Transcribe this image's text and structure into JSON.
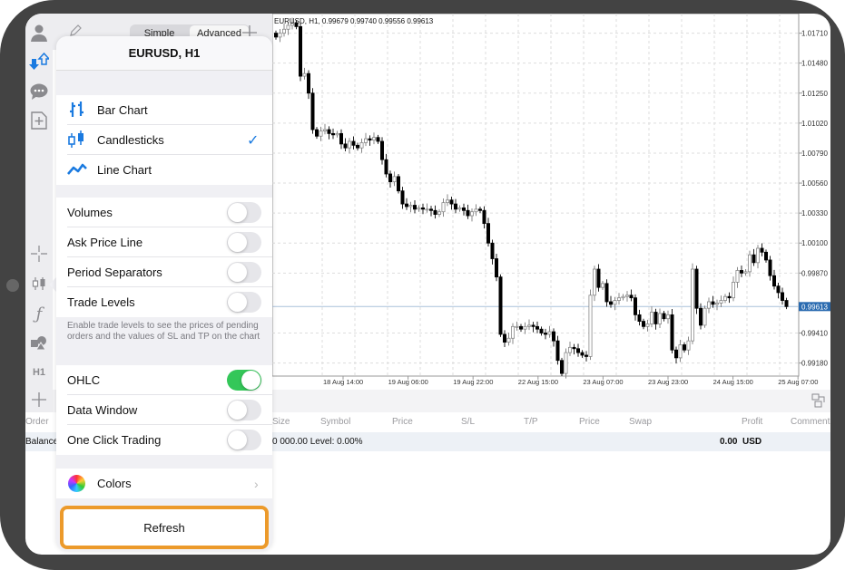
{
  "toolbar": {
    "mode_simple": "Simple",
    "mode_advanced": "Advanced",
    "active_mode": "Advanced"
  },
  "popover": {
    "title": "EURUSD, H1",
    "chart_types": [
      {
        "label": "Bar Chart",
        "icon": "bar-chart-icon",
        "selected": false
      },
      {
        "label": "Candlesticks",
        "icon": "candlestick-icon",
        "selected": true
      },
      {
        "label": "Line Chart",
        "icon": "line-chart-icon",
        "selected": false
      }
    ],
    "check_glyph": "✓",
    "toggles": [
      {
        "label": "Volumes",
        "on": false
      },
      {
        "label": "Ask Price Line",
        "on": false
      },
      {
        "label": "Period Separators",
        "on": false
      },
      {
        "label": "Trade Levels",
        "on": false
      }
    ],
    "note": "Enable trade levels to see the prices of pending orders and the values of SL and TP on the chart",
    "toggles2": [
      {
        "label": "OHLC",
        "on": true
      },
      {
        "label": "Data Window",
        "on": false
      },
      {
        "label": "One Click Trading",
        "on": false
      }
    ],
    "colors_label": "Colors",
    "refresh_label": "Refresh",
    "accent": "#1a7ae0",
    "toggle_on": "#34c759",
    "highlight": "#ec9a2b"
  },
  "sidebar": {
    "timeframe": "H1"
  },
  "chart_data": {
    "type": "candlestick",
    "title": "EURUSD, H1, 0.99679 0.99740 0.99556 0.99613",
    "y_ticks": [
      "1.01710",
      "1.01480",
      "1.01250",
      "1.01020",
      "1.00790",
      "1.00560",
      "1.00330",
      "1.00100",
      "0.99870",
      "0.99410",
      "0.99180"
    ],
    "x_ticks": [
      "18 Aug 14:00",
      "19 Aug 06:00",
      "19 Aug 22:00",
      "22 Aug 15:00",
      "23 Aug 07:00",
      "23 Aug 23:00",
      "24 Aug 15:00",
      "25 Aug 07:00"
    ],
    "bid": "0.99613",
    "ylim": [
      0.9908,
      1.0186
    ],
    "grid": true,
    "closes": [
      1.0168,
      1.0171,
      1.0174,
      1.0177,
      1.0179,
      1.0176,
      1.0138,
      1.014,
      1.0125,
      1.0097,
      1.0092,
      1.0096,
      1.0097,
      1.0094,
      1.0093,
      1.0094,
      1.0086,
      1.0083,
      1.0088,
      1.0085,
      1.0083,
      1.0087,
      1.009,
      1.0089,
      1.0091,
      1.0088,
      1.0074,
      1.0063,
      1.0057,
      1.0061,
      1.005,
      1.004,
      1.0038,
      1.0039,
      1.0036,
      1.0037,
      1.0036,
      1.0036,
      1.0035,
      1.0032,
      1.0034,
      1.0041,
      1.0043,
      1.004,
      1.0036,
      1.0037,
      1.0035,
      1.0031,
      1.0034,
      1.0036,
      1.0035,
      1.0025,
      1.001,
      0.9998,
      0.9984,
      0.994,
      0.9934,
      0.9937,
      0.9946,
      0.9946,
      0.9944,
      0.9946,
      0.9947,
      0.9946,
      0.9944,
      0.9941,
      0.994,
      0.9942,
      0.9935,
      0.992,
      0.991,
      0.9926,
      0.993,
      0.9929,
      0.9926,
      0.9924,
      0.9923,
      0.997,
      0.999,
      0.9976,
      0.9979,
      0.9965,
      0.9963,
      0.9966,
      0.9968,
      0.9969,
      0.997,
      0.9968,
      0.9955,
      0.995,
      0.9946,
      0.9948,
      0.9957,
      0.9948,
      0.9956,
      0.9952,
      0.9955,
      0.9928,
      0.9922,
      0.9932,
      0.9928,
      0.9935,
      0.999,
      0.996,
      0.9947,
      0.996,
      0.9965,
      0.9963,
      0.9964,
      0.9966,
      0.9969,
      0.9968,
      0.998,
      0.9989,
      0.9987,
      0.9988,
      1.0001,
      0.9995,
      1.0006,
      1.0003,
      0.9997,
      0.9985,
      0.9977,
      0.9972,
      0.9966,
      0.99613
    ]
  },
  "table": {
    "headers": [
      "Order",
      "Size",
      "Symbol",
      "Price",
      "S/L",
      "T/P",
      "Price",
      "Swap",
      "Profit",
      "Comment"
    ],
    "balance_label": "Balance",
    "balance_text": "0 000.00 Level: 0.00%",
    "profit": "0.00",
    "currency": "USD"
  }
}
